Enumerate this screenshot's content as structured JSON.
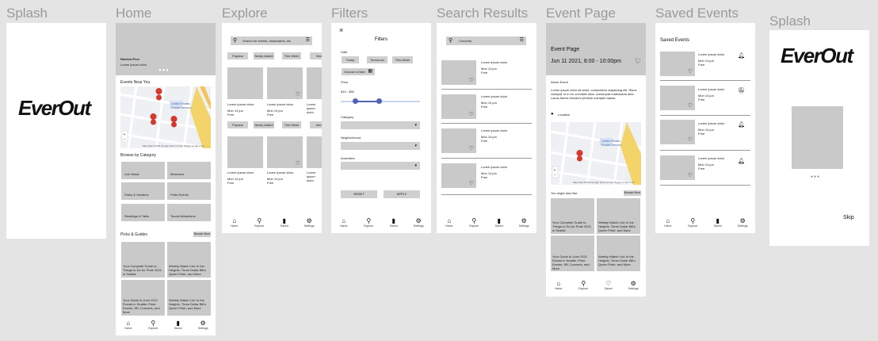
{
  "labels": {
    "splash1": "Splash",
    "home": "Home",
    "explore": "Explore",
    "filters": "Filters",
    "search_results": "Search Results",
    "event_page": "Event Page",
    "saved_events": "Saved Events",
    "splash2": "Splash"
  },
  "brand": "EverOut",
  "nav": [
    "Home",
    "Explore",
    "Saved",
    "Settings"
  ],
  "nav_icons": [
    "home-icon",
    "search-icon",
    "bookmark-icon",
    "gear-icon"
  ],
  "colors": {
    "canvas": "#e4e4e4",
    "placeholder": "#c9c9c9",
    "pin": "#d33a2f",
    "slider": "#5560b8"
  },
  "home": {
    "hero_title": "Ranked Pics",
    "hero_sub": "Lorem ipsum dolor",
    "events_near_you": "Events Near You",
    "map_credit": "Map data ©2019 Google",
    "map_terms": "Terms of Use",
    "map_report": "Report a map error",
    "browse_by_category": "Browse by Category",
    "categories": [
      "Live Music",
      "Museums",
      "Parks & Gardens",
      "Pride Events",
      "Readings & Talks",
      "Tourist Attractions"
    ],
    "picks_guides": "Picks & Guides",
    "browse_more": "Browse More",
    "guides": [
      "Your Complete Guide to Things to Do for Pride 2021 in Seattle",
      "Weekly Watch List: In the Heights, Three Dollar Bill's Queer Pride, and More",
      "Your Guide to June 2021 Events in Seattle: Pride Events, IRL Concerts, and More",
      "Weekly Watch List: In the Heights, Three Dollar Bill's Queer Pride, and More"
    ]
  },
  "explore": {
    "search_placeholder": "Search for events, restaurants, etc",
    "chips": [
      "Popular",
      "Newly Added",
      "This Week",
      "Next"
    ],
    "card_title": "Lorem ipsum dolor",
    "card_meta1": "Mon 14 jun",
    "card_meta2": "Free"
  },
  "filters": {
    "title": "Filters",
    "date": "Date",
    "date_chips": [
      "Today",
      "Tomorrow",
      "This Week"
    ],
    "choose_date": "Choose a Date",
    "price": "Price",
    "price_range": "$10 - $50",
    "category": "Category",
    "neighborhood": "Neighborhood",
    "amenities": "Amenities",
    "reset": "RESET",
    "apply": "APPLY"
  },
  "search_results": {
    "query": "Concerts",
    "item_title": "Lorem ipsum dolor",
    "item_meta1": "Mon 14 jun",
    "item_meta2": "Free"
  },
  "event_page": {
    "title": "Event Page",
    "date": "Jun 11 2021, 8:00 - 10:00pm",
    "about": "About Event",
    "description": "Lorem ipsum dolor sit amet, consectetur adipiscing elit. Risus volutpat, id in eu convallis dolor consequat malesuada ante. Lacus fames tincidunt pretium volutpat massa.",
    "location": "Location",
    "you_might_also_like": "You might also like:",
    "browse_more": "Browse More",
    "nav": [
      "Home",
      "Explore",
      "Saved",
      "Settings"
    ]
  },
  "saved_events": {
    "title": "Saved Events",
    "item_title": "Lorem ipsum dolor",
    "item_meta1": "Mon 14 jun",
    "item_meta2": "Free"
  },
  "splash2": {
    "skip": "Skip"
  }
}
